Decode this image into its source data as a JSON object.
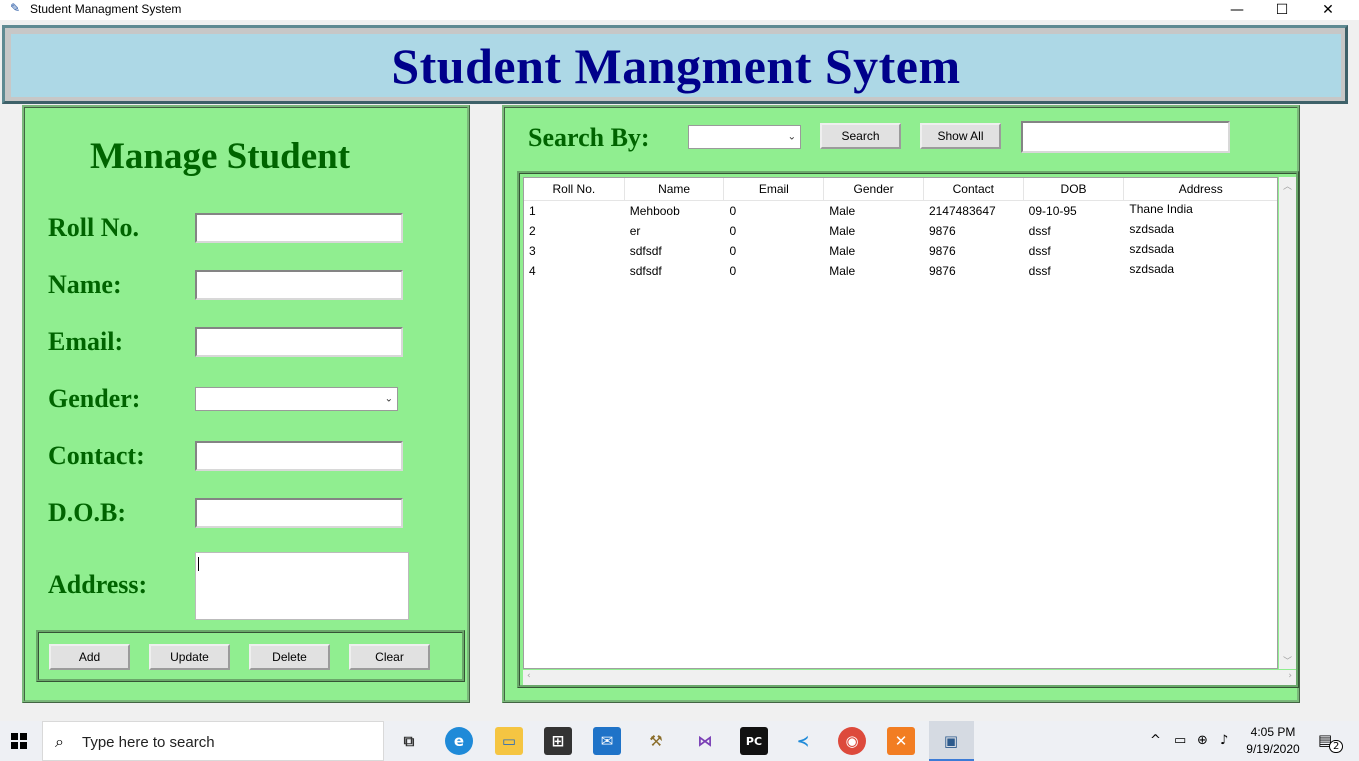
{
  "window": {
    "title": "Student Managment System",
    "minimize_glyph": "—",
    "maximize_glyph": "☐",
    "close_glyph": "✕"
  },
  "header": {
    "title": "Student Mangment Sytem"
  },
  "manage": {
    "title": "Manage Student",
    "labels": {
      "roll": "Roll No.",
      "name": "Name:",
      "email": "Email:",
      "gender": "Gender:",
      "contact": "Contact:",
      "dob": "D.O.B:",
      "address": "Address:"
    },
    "values": {
      "roll": "",
      "name": "",
      "email": "",
      "gender": "",
      "contact": "",
      "dob": "",
      "address": ""
    },
    "buttons": {
      "add": "Add",
      "update": "Update",
      "delete": "Delete",
      "clear": "Clear"
    }
  },
  "search": {
    "label": "Search By:",
    "search_by_value": "",
    "search_button": "Search",
    "show_all_button": "Show All",
    "text_value": ""
  },
  "table": {
    "columns": [
      "Roll No.",
      "Name",
      "Email",
      "Gender",
      "Contact",
      "DOB",
      "Address"
    ],
    "rows": [
      [
        "1",
        "Mehboob",
        "0",
        "Male",
        "2147483647",
        "09-10-95",
        "Thane India"
      ],
      [
        "2",
        "er",
        "0",
        "Male",
        "9876",
        "dssf",
        "szdsada"
      ],
      [
        "3",
        "sdfsdf",
        "0",
        "Male",
        "9876",
        "dssf",
        "szdsada"
      ],
      [
        "4",
        "sdfsdf",
        "0",
        "Male",
        "9876",
        "dssf",
        "szdsada"
      ]
    ]
  },
  "taskbar": {
    "search_placeholder": "Type here to search",
    "time": "4:05 PM",
    "date": "9/19/2020",
    "notification_count": "2",
    "apps": [
      "task-view",
      "edge",
      "file-explorer",
      "store",
      "mail",
      "tool",
      "visual-studio",
      "pycharm",
      "vscode",
      "chrome",
      "xampp",
      "python"
    ]
  },
  "colors": {
    "panel_bg": "#90ee90",
    "header_bg": "#add8e6",
    "header_text": "#00008b",
    "label_text": "#006400"
  }
}
